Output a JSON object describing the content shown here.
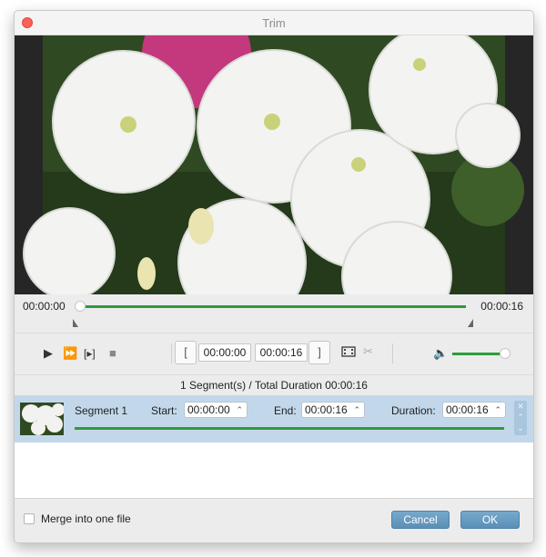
{
  "window": {
    "title": "Trim"
  },
  "timeline": {
    "start_time": "00:00:00",
    "end_time": "00:00:16",
    "progress": 0
  },
  "controls": {
    "start_time": "00:00:00",
    "end_time": "00:00:16",
    "volume_level": 0.9,
    "icons": [
      "play-icon",
      "fast-forward-icon",
      "play-selection-icon",
      "stop-icon",
      "set-start-bracket-icon",
      "set-end-bracket-icon",
      "add-segment-icon",
      "split-scissors-icon",
      "volume-icon"
    ]
  },
  "summary": {
    "text": "1 Segment(s) / Total Duration 00:00:16"
  },
  "segments": [
    {
      "name": "Segment 1",
      "start_label": "Start:",
      "start": "00:00:00",
      "end_label": "End:",
      "end": "00:00:16",
      "duration_label": "Duration:",
      "duration": "00:00:16"
    }
  ],
  "footer": {
    "merge_label": "Merge into one file",
    "merge_checked": false,
    "cancel_label": "Cancel",
    "ok_label": "OK"
  },
  "colors": {
    "accent_green": "#2e9b3a",
    "selection_blue": "#c2d8ea",
    "button_blue": "#6a9ec3"
  }
}
